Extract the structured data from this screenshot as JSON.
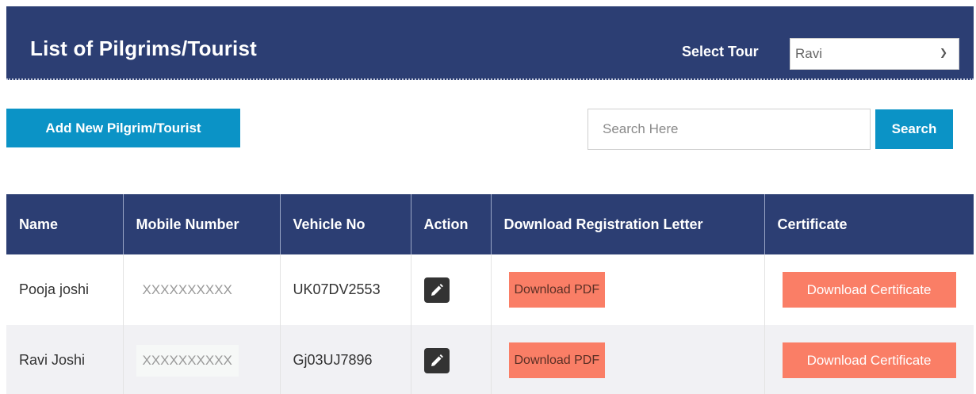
{
  "header": {
    "title": "List of Pilgrims/Tourist",
    "tour_label": "Select Tour",
    "tour_selected": "Ravi"
  },
  "toolbar": {
    "add_label": "Add New Pilgrim/Tourist",
    "search_placeholder": "Search Here",
    "search_label": "Search"
  },
  "table": {
    "columns": [
      "Name",
      "Mobile Number",
      "Vehicle No",
      "Action",
      "Download Registration Letter",
      "Certificate"
    ],
    "rows": [
      {
        "name": "Pooja joshi",
        "mobile": "XXXXXXXXXX",
        "vehicle": "UK07DV2553",
        "pdf_label": "Download PDF",
        "cert_label": "Download Certificate"
      },
      {
        "name": "Ravi Joshi",
        "mobile": "XXXXXXXXXX",
        "vehicle": "Gj03UJ7896",
        "pdf_label": "Download PDF",
        "cert_label": "Download Certificate"
      }
    ]
  },
  "colors": {
    "header_bg": "#2c3e73",
    "primary_button": "#0b93c6",
    "download_button": "#fa7e66"
  }
}
